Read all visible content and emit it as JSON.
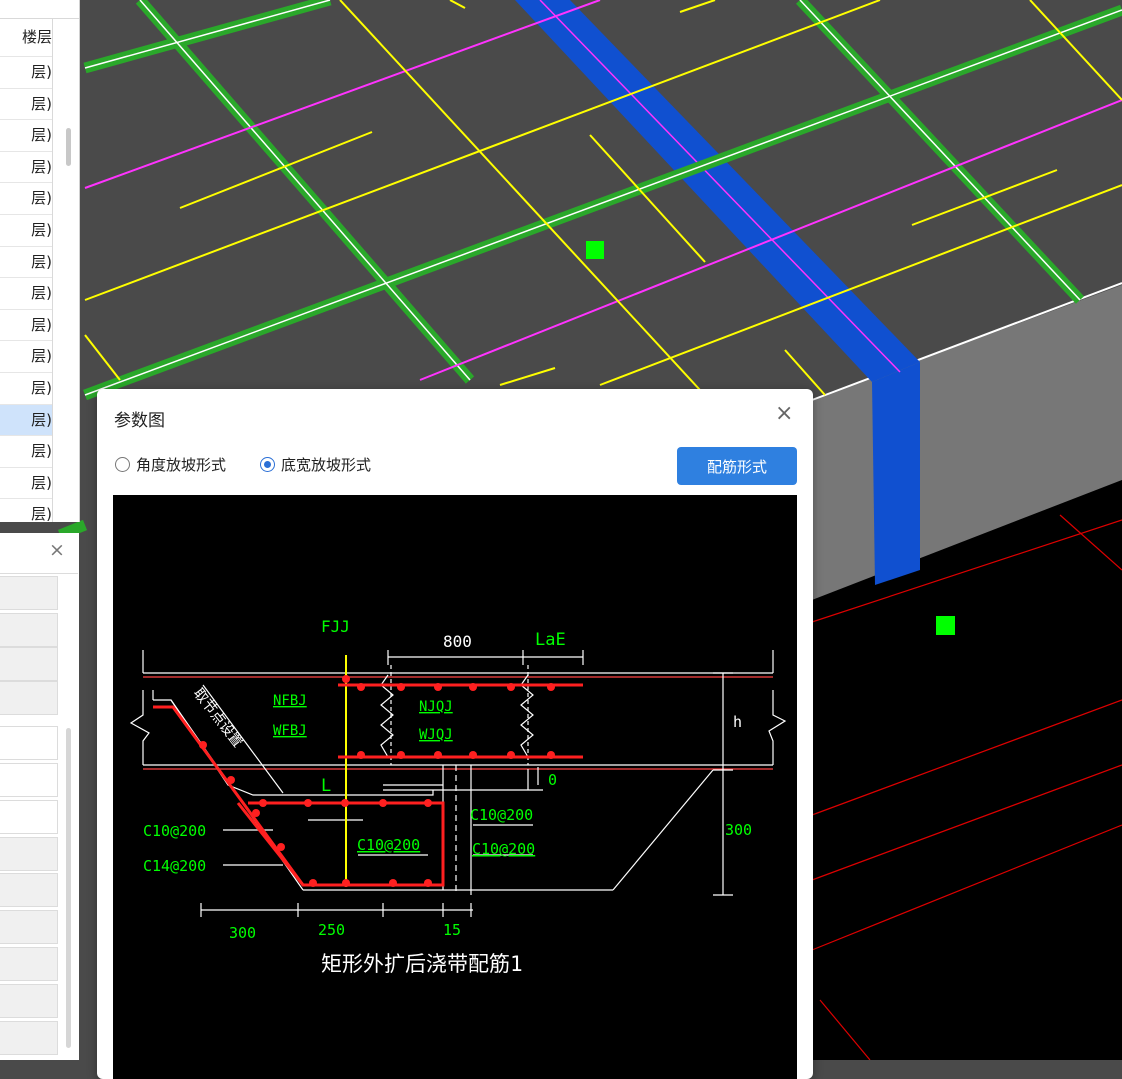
{
  "floor_list": {
    "header": "楼层",
    "rows": [
      "层)",
      "层)",
      "层)",
      "层)",
      "层)",
      "层)",
      "层)",
      "层)",
      "层)",
      "层)",
      "层)",
      "层)",
      "层)",
      "层)",
      "层)"
    ],
    "selected_index": 11
  },
  "props_panel": {
    "close_glyph": "×"
  },
  "dialog": {
    "title": "参数图",
    "close_glyph": "×",
    "options": [
      {
        "label": "角度放坡形式",
        "selected": false
      },
      {
        "label": "底宽放坡形式",
        "selected": true
      }
    ],
    "rebar_button": "配筋形式"
  },
  "drawing": {
    "labels": {
      "fjj": "FJJ",
      "dim_800": "800",
      "lae": "LaE",
      "nfbj": "NFBJ",
      "wfbj": "WFBJ",
      "njqj": "NJQJ",
      "wjqj": "WJQJ",
      "h": "h",
      "zero": "0",
      "l": "L",
      "anchor_note": "取节点设置",
      "c10_left": "C10@200",
      "c14_left": "C14@200",
      "c10_mid": "C10@200",
      "c10_right1": "C10@200",
      "c10_right2": "C10@200",
      "dim_300_right": "300",
      "dim_300": "300",
      "dim_250": "250",
      "dim_15": "15",
      "caption": "矩形外扩后浇带配筋1"
    }
  },
  "colors": {
    "accent": "#2f80e0",
    "green_bar": "#2aa82a",
    "blue_band": "#1050d0",
    "yellow": "#ffff00",
    "magenta": "#ff33ff",
    "red": "#ff0000"
  }
}
